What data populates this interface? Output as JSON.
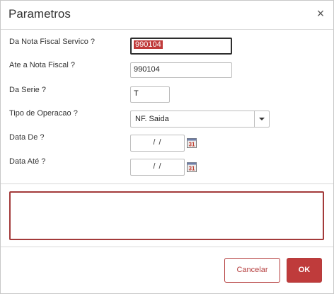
{
  "dialog": {
    "title": "Parametros",
    "close_icon": "×"
  },
  "fields": {
    "nota_fiscal_de": {
      "label": "Da Nota Fiscal Servico ?",
      "value": "990104"
    },
    "nota_fiscal_ate": {
      "label": "Ate a Nota Fiscal ?",
      "value": "990104"
    },
    "serie": {
      "label": "Da Serie ?",
      "value": "T"
    },
    "tipo_operacao": {
      "label": "Tipo de Operacao ?",
      "value": "NF. Saida"
    },
    "data_de": {
      "label": "Data De ?",
      "value": "/ /"
    },
    "data_ate": {
      "label": "Data Até ?",
      "value": "/ /"
    }
  },
  "calendar_icon": {
    "text": "31",
    "color": "#c0392b"
  },
  "buttons": {
    "cancel": "Cancelar",
    "ok": "OK"
  },
  "colors": {
    "accent": "#bf3b3b",
    "border": "#bdbdbd"
  }
}
